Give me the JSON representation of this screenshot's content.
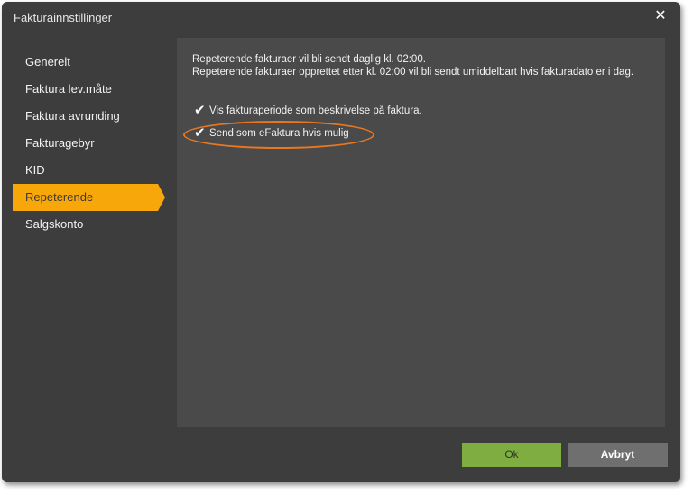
{
  "window": {
    "title": "Fakturainnstillinger",
    "close_icon": "close-icon"
  },
  "sidebar": {
    "items": [
      {
        "label": "Generelt",
        "active": false
      },
      {
        "label": "Faktura lev.måte",
        "active": false
      },
      {
        "label": "Faktura avrunding",
        "active": false
      },
      {
        "label": "Fakturagebyr",
        "active": false
      },
      {
        "label": "KID",
        "active": false
      },
      {
        "label": "Repeterende",
        "active": true
      },
      {
        "label": "Salgskonto",
        "active": false
      }
    ]
  },
  "main": {
    "info_line1": "Repeterende fakturaer vil bli sendt daglig kl. 02:00.",
    "info_line2": "Repeterende fakturaer opprettet etter kl. 02:00 vil bli sendt umiddelbart hvis fakturadato er i dag.",
    "checkboxes": [
      {
        "label": "Vis fakturaperiode som beskrivelse på faktura.",
        "checked": true
      },
      {
        "label": "Send som eFaktura hvis mulig",
        "checked": true
      }
    ]
  },
  "footer": {
    "ok_label": "Ok",
    "cancel_label": "Avbryt"
  },
  "colors": {
    "accent": "#f7a70a",
    "ok_button": "#7fad41",
    "highlight_ring": "#e87722"
  }
}
